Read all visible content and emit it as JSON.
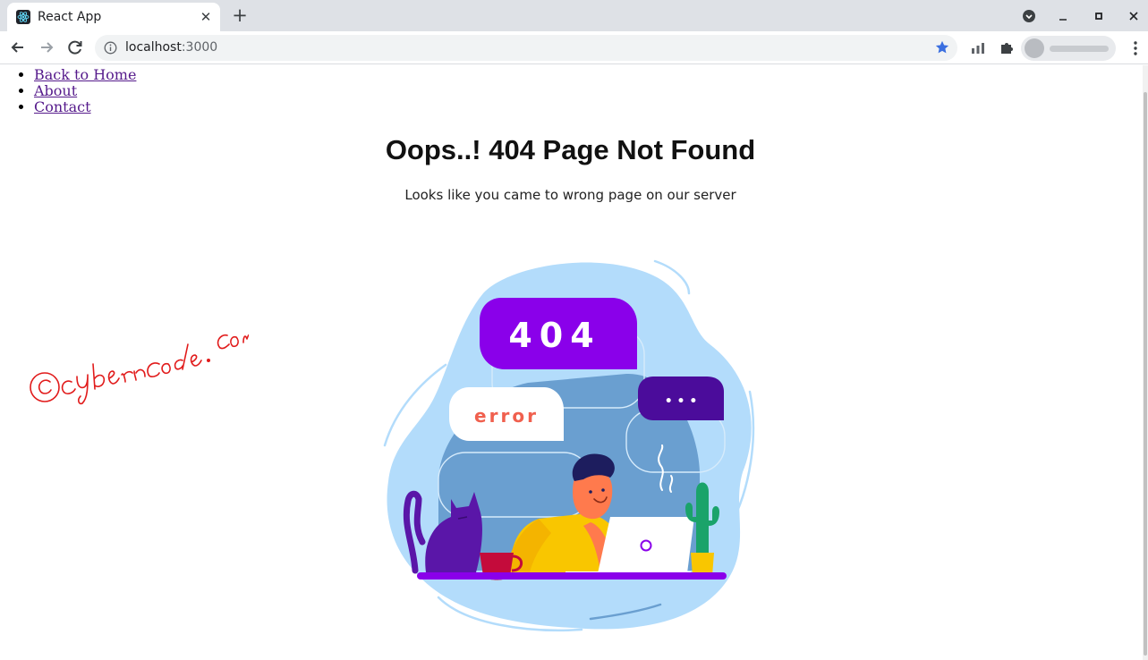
{
  "browser": {
    "tab_title": "React App",
    "tab_close": "✕",
    "new_tab": "+",
    "url_host": "localhost",
    "url_port": ":3000"
  },
  "nav": {
    "items": [
      {
        "label": "Back to Home"
      },
      {
        "label": "About"
      },
      {
        "label": "Contact"
      }
    ]
  },
  "page": {
    "title": "Oops..! 404 Page Not Found",
    "subtitle": "Looks like you came to wrong page on our server"
  },
  "illustration": {
    "bubble_404": "404",
    "bubble_error": "error",
    "bubble_dots": "• • •"
  },
  "watermark": {
    "text": "©cybernCode.com"
  },
  "colors": {
    "accent_purple": "#8a00ea",
    "dark_purple": "#4b0c9b",
    "light_blue": "#b3dcfb",
    "mid_blue": "#6a9fd0",
    "error_text": "#f0604e",
    "link": "#551a8b",
    "star": "#3b6fe0",
    "watermark": "#e11b1b"
  }
}
